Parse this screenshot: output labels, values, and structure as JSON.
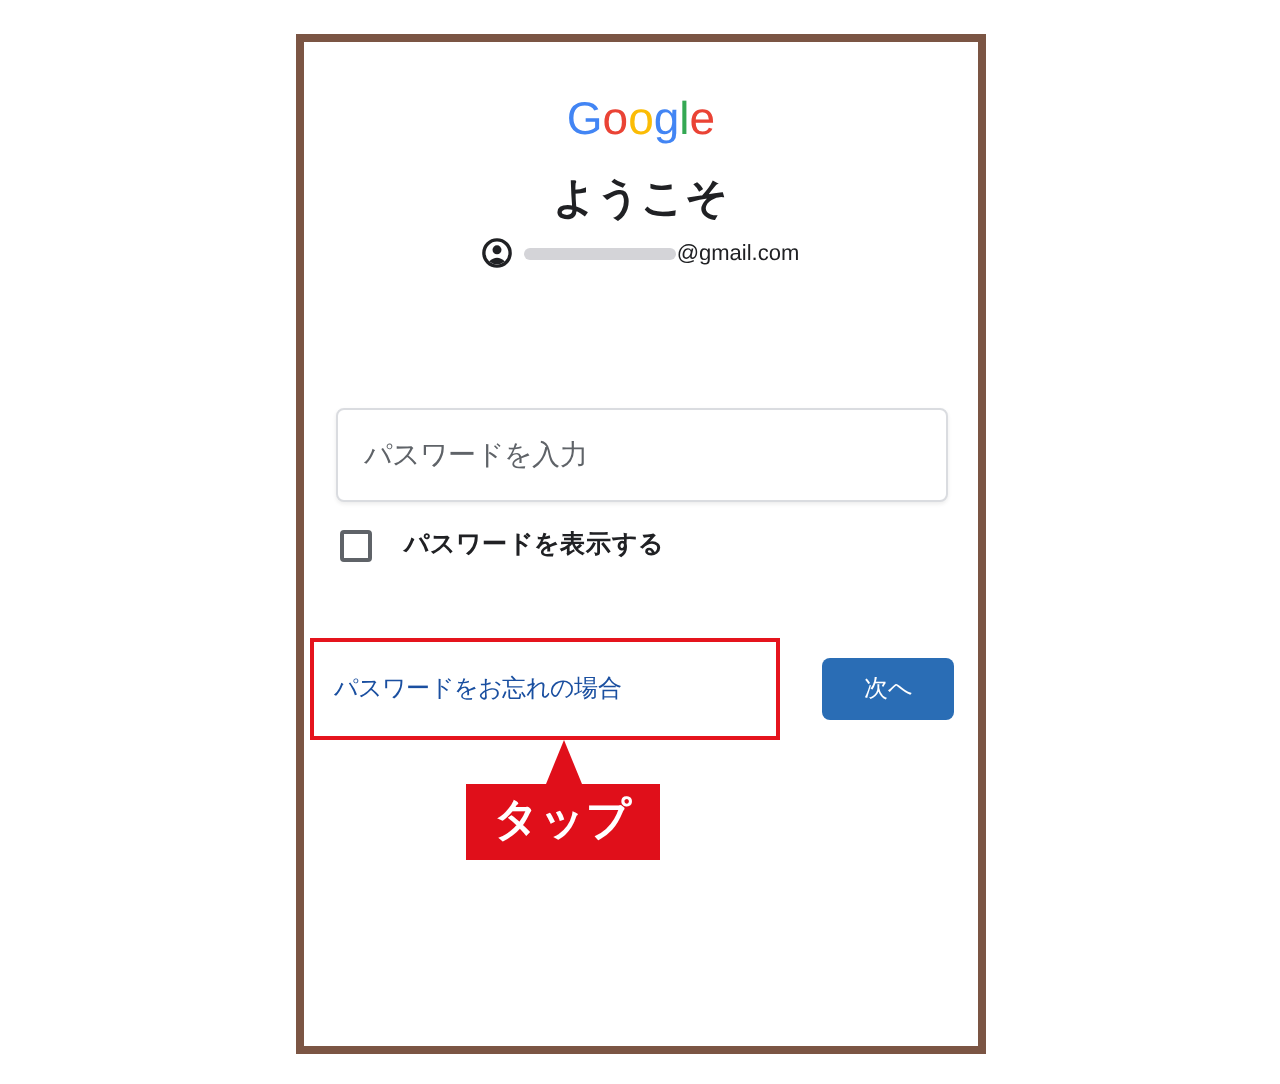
{
  "logo": [
    {
      "char": "G",
      "color": "#4285f4"
    },
    {
      "char": "o",
      "color": "#ea4335"
    },
    {
      "char": "o",
      "color": "#fbbc05"
    },
    {
      "char": "g",
      "color": "#4285f4"
    },
    {
      "char": "l",
      "color": "#34a853"
    },
    {
      "char": "e",
      "color": "#ea4335"
    }
  ],
  "heading": "ようこそ",
  "account": {
    "masked": true,
    "email_suffix": "@gmail.com"
  },
  "password_field": {
    "placeholder": "パスワードを入力"
  },
  "show_password": {
    "label": "パスワードを表示する",
    "checked": false
  },
  "forgot_link": "パスワードをお忘れの場合",
  "next_button": "次へ",
  "annotation": {
    "label": "タップ"
  }
}
